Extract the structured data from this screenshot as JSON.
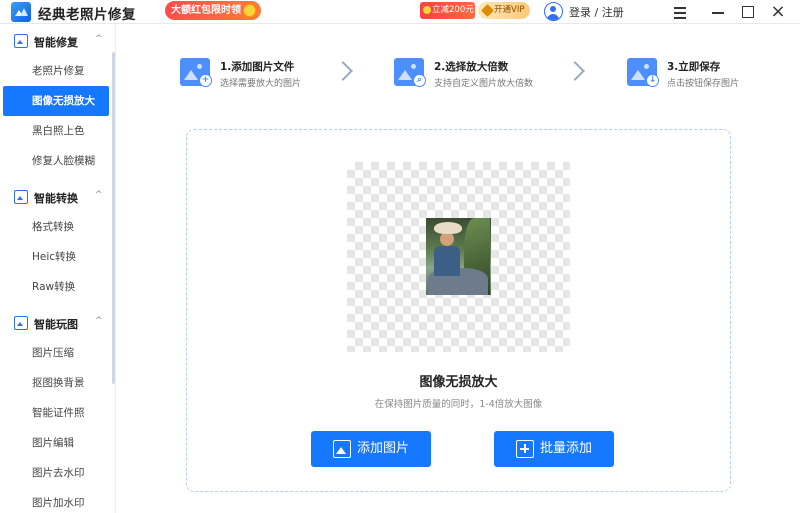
{
  "titlebar": {
    "app_title": "经典老照片修复",
    "promo_text": "大额红包限时领",
    "coupon_text": "立减200元",
    "vip_text": "开通VIP",
    "login_text": "登录 / 注册",
    "close_glyph": "×"
  },
  "sidebar": {
    "groups": [
      {
        "title": "智能修复",
        "items": [
          "老照片修复",
          "图像无损放大",
          "黑白照上色",
          "修复人脸模糊"
        ]
      },
      {
        "title": "智能转换",
        "items": [
          "格式转换",
          "Heic转换",
          "Raw转换"
        ]
      },
      {
        "title": "智能玩图",
        "items": [
          "图片压缩",
          "抠图换背景",
          "智能证件照",
          "图片编辑",
          "图片去水印",
          "图片加水印"
        ]
      }
    ],
    "active_item": "图像无损放大",
    "chevron": "^"
  },
  "steps": [
    {
      "title": "1.添加图片文件",
      "desc": "选择需要放大的图片",
      "badge": "+"
    },
    {
      "title": "2.选择放大倍数",
      "desc": "支持自定义图片放大倍数",
      "badge": "⌕"
    },
    {
      "title": "3.立即保存",
      "desc": "点击按钮保存图片",
      "badge": "↓"
    }
  ],
  "main": {
    "title": "图像无损放大",
    "subtitle": "在保持图片质量的同时，1-4倍放大图像",
    "add_button": "添加图片",
    "batch_button": "批量添加"
  },
  "colors": {
    "accent": "#1677ff",
    "promo": "#ff4b4b",
    "vip": "#ffc978"
  }
}
